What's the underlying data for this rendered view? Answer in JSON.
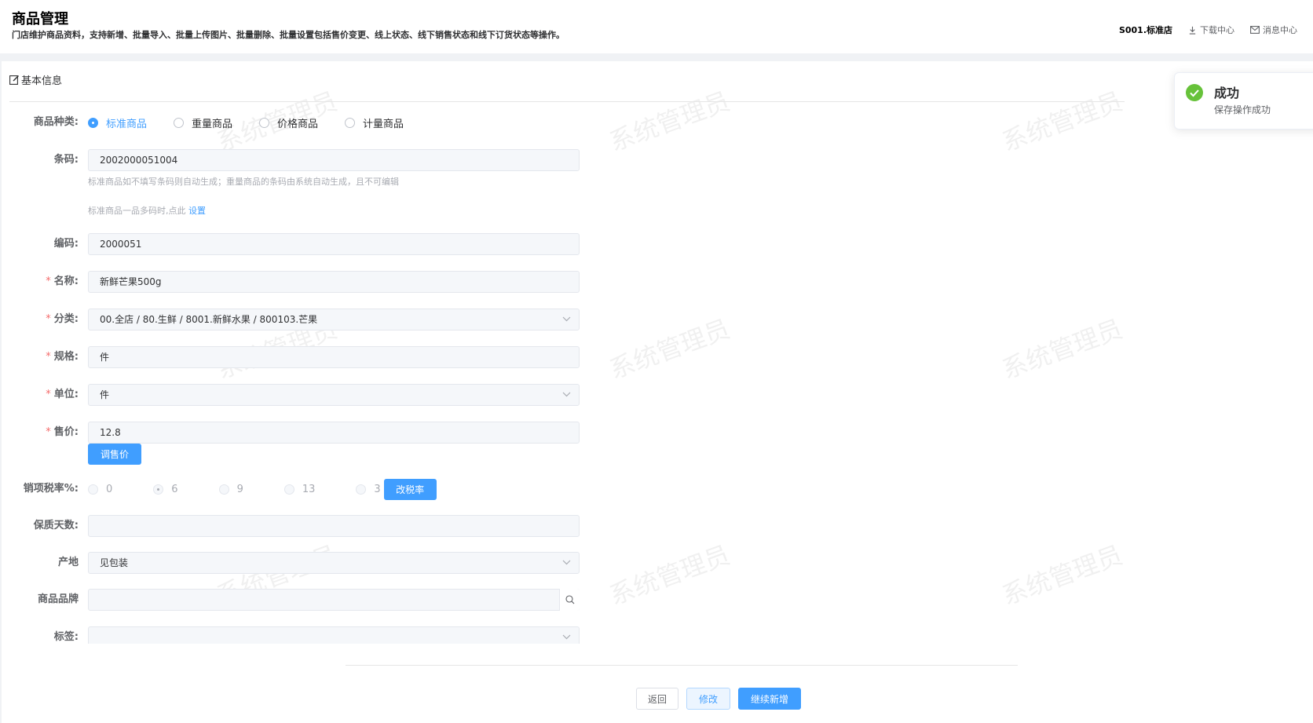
{
  "header": {
    "title": "商品管理",
    "description": "门店维护商品资料，支持新增、批量导入、批量上传图片、批量删除、批量设置包括售价变更、线上状态、线下销售状态和线下订货状态等操作。",
    "store": "S001.标准店",
    "download_center": "下载中心",
    "message_center": "消息中心"
  },
  "section": {
    "title": "基本信息"
  },
  "watermark": "系统管理员",
  "form": {
    "type": {
      "label": "商品种类:",
      "options": [
        "标准商品",
        "重量商品",
        "价格商品",
        "计量商品"
      ],
      "selected": "标准商品"
    },
    "barcode": {
      "label": "条码:",
      "value": "2002000051004",
      "hint1": "标准商品如不填写条码则自动生成；重量商品的条码由系统自动生成，且不可编辑",
      "hint2_prefix": "标准商品一品多码时,点此",
      "hint2_link": "设置"
    },
    "code": {
      "label": "编码:",
      "value": "2000051"
    },
    "name": {
      "label": "名称:",
      "value": "新鲜芒果500g"
    },
    "category": {
      "label": "分类:",
      "value": "00.全店 / 80.生鲜 / 8001.新鲜水果 / 800103.芒果"
    },
    "spec": {
      "label": "规格:",
      "value": "件"
    },
    "unit": {
      "label": "单位:",
      "value": "件"
    },
    "price": {
      "label": "售价:",
      "value": "12.8",
      "adjust_button": "调售价"
    },
    "tax": {
      "label": "销项税率%:",
      "options": [
        "0",
        "6",
        "9",
        "13",
        "3"
      ],
      "selected": "6",
      "change_button": "改税率"
    },
    "shelf_life": {
      "label": "保质天数:",
      "value": ""
    },
    "origin": {
      "label": "产地",
      "value": "见包装"
    },
    "brand": {
      "label": "商品品牌",
      "value": ""
    },
    "tags": {
      "label": "标签:",
      "value": ""
    }
  },
  "footer": {
    "back": "返回",
    "edit": "修改",
    "continue": "继续新增"
  },
  "toast": {
    "title": "成功",
    "message": "保存操作成功"
  }
}
